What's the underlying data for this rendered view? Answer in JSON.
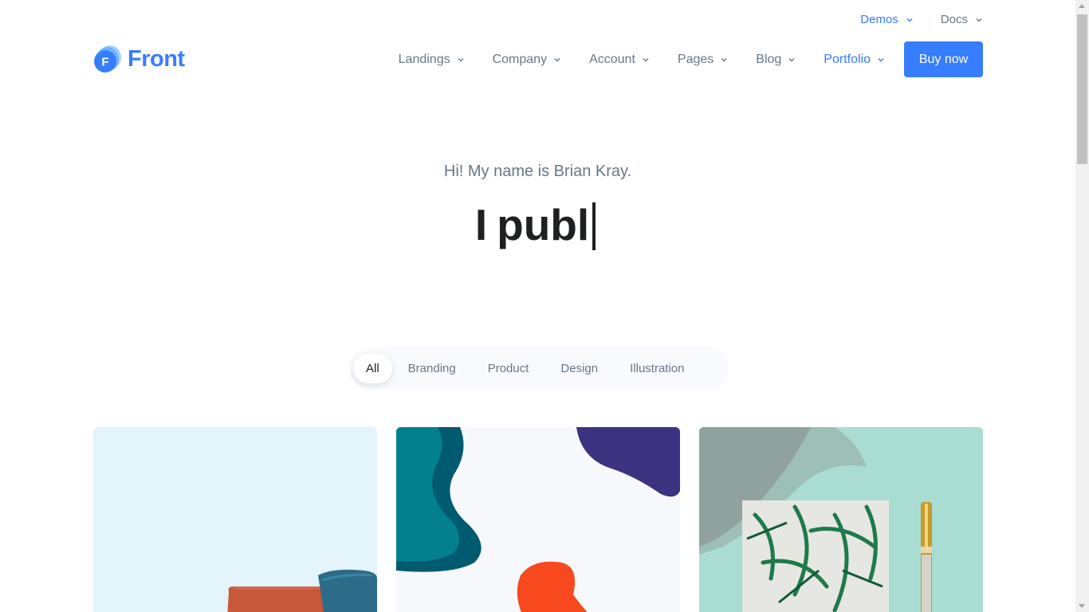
{
  "topbar": {
    "demos_label": "Demos",
    "docs_label": "Docs"
  },
  "brand": {
    "logo_letter": "F",
    "name": "Front",
    "color": "#377dff"
  },
  "nav": {
    "items": [
      {
        "label": "Landings"
      },
      {
        "label": "Company"
      },
      {
        "label": "Account"
      },
      {
        "label": "Pages"
      },
      {
        "label": "Blog"
      },
      {
        "label": "Portfolio"
      }
    ],
    "buy_label": "Buy now"
  },
  "hero": {
    "subtitle": "Hi! My name is Brian Kray.",
    "title_prefix": "I",
    "title_typed": "publ"
  },
  "filter": {
    "tabs": [
      {
        "label": "All"
      },
      {
        "label": "Branding"
      },
      {
        "label": "Product"
      },
      {
        "label": "Design"
      },
      {
        "label": "Illustration"
      }
    ]
  },
  "colors": {
    "primary": "#377dff",
    "text": "#677788",
    "dark": "#1e2022"
  }
}
